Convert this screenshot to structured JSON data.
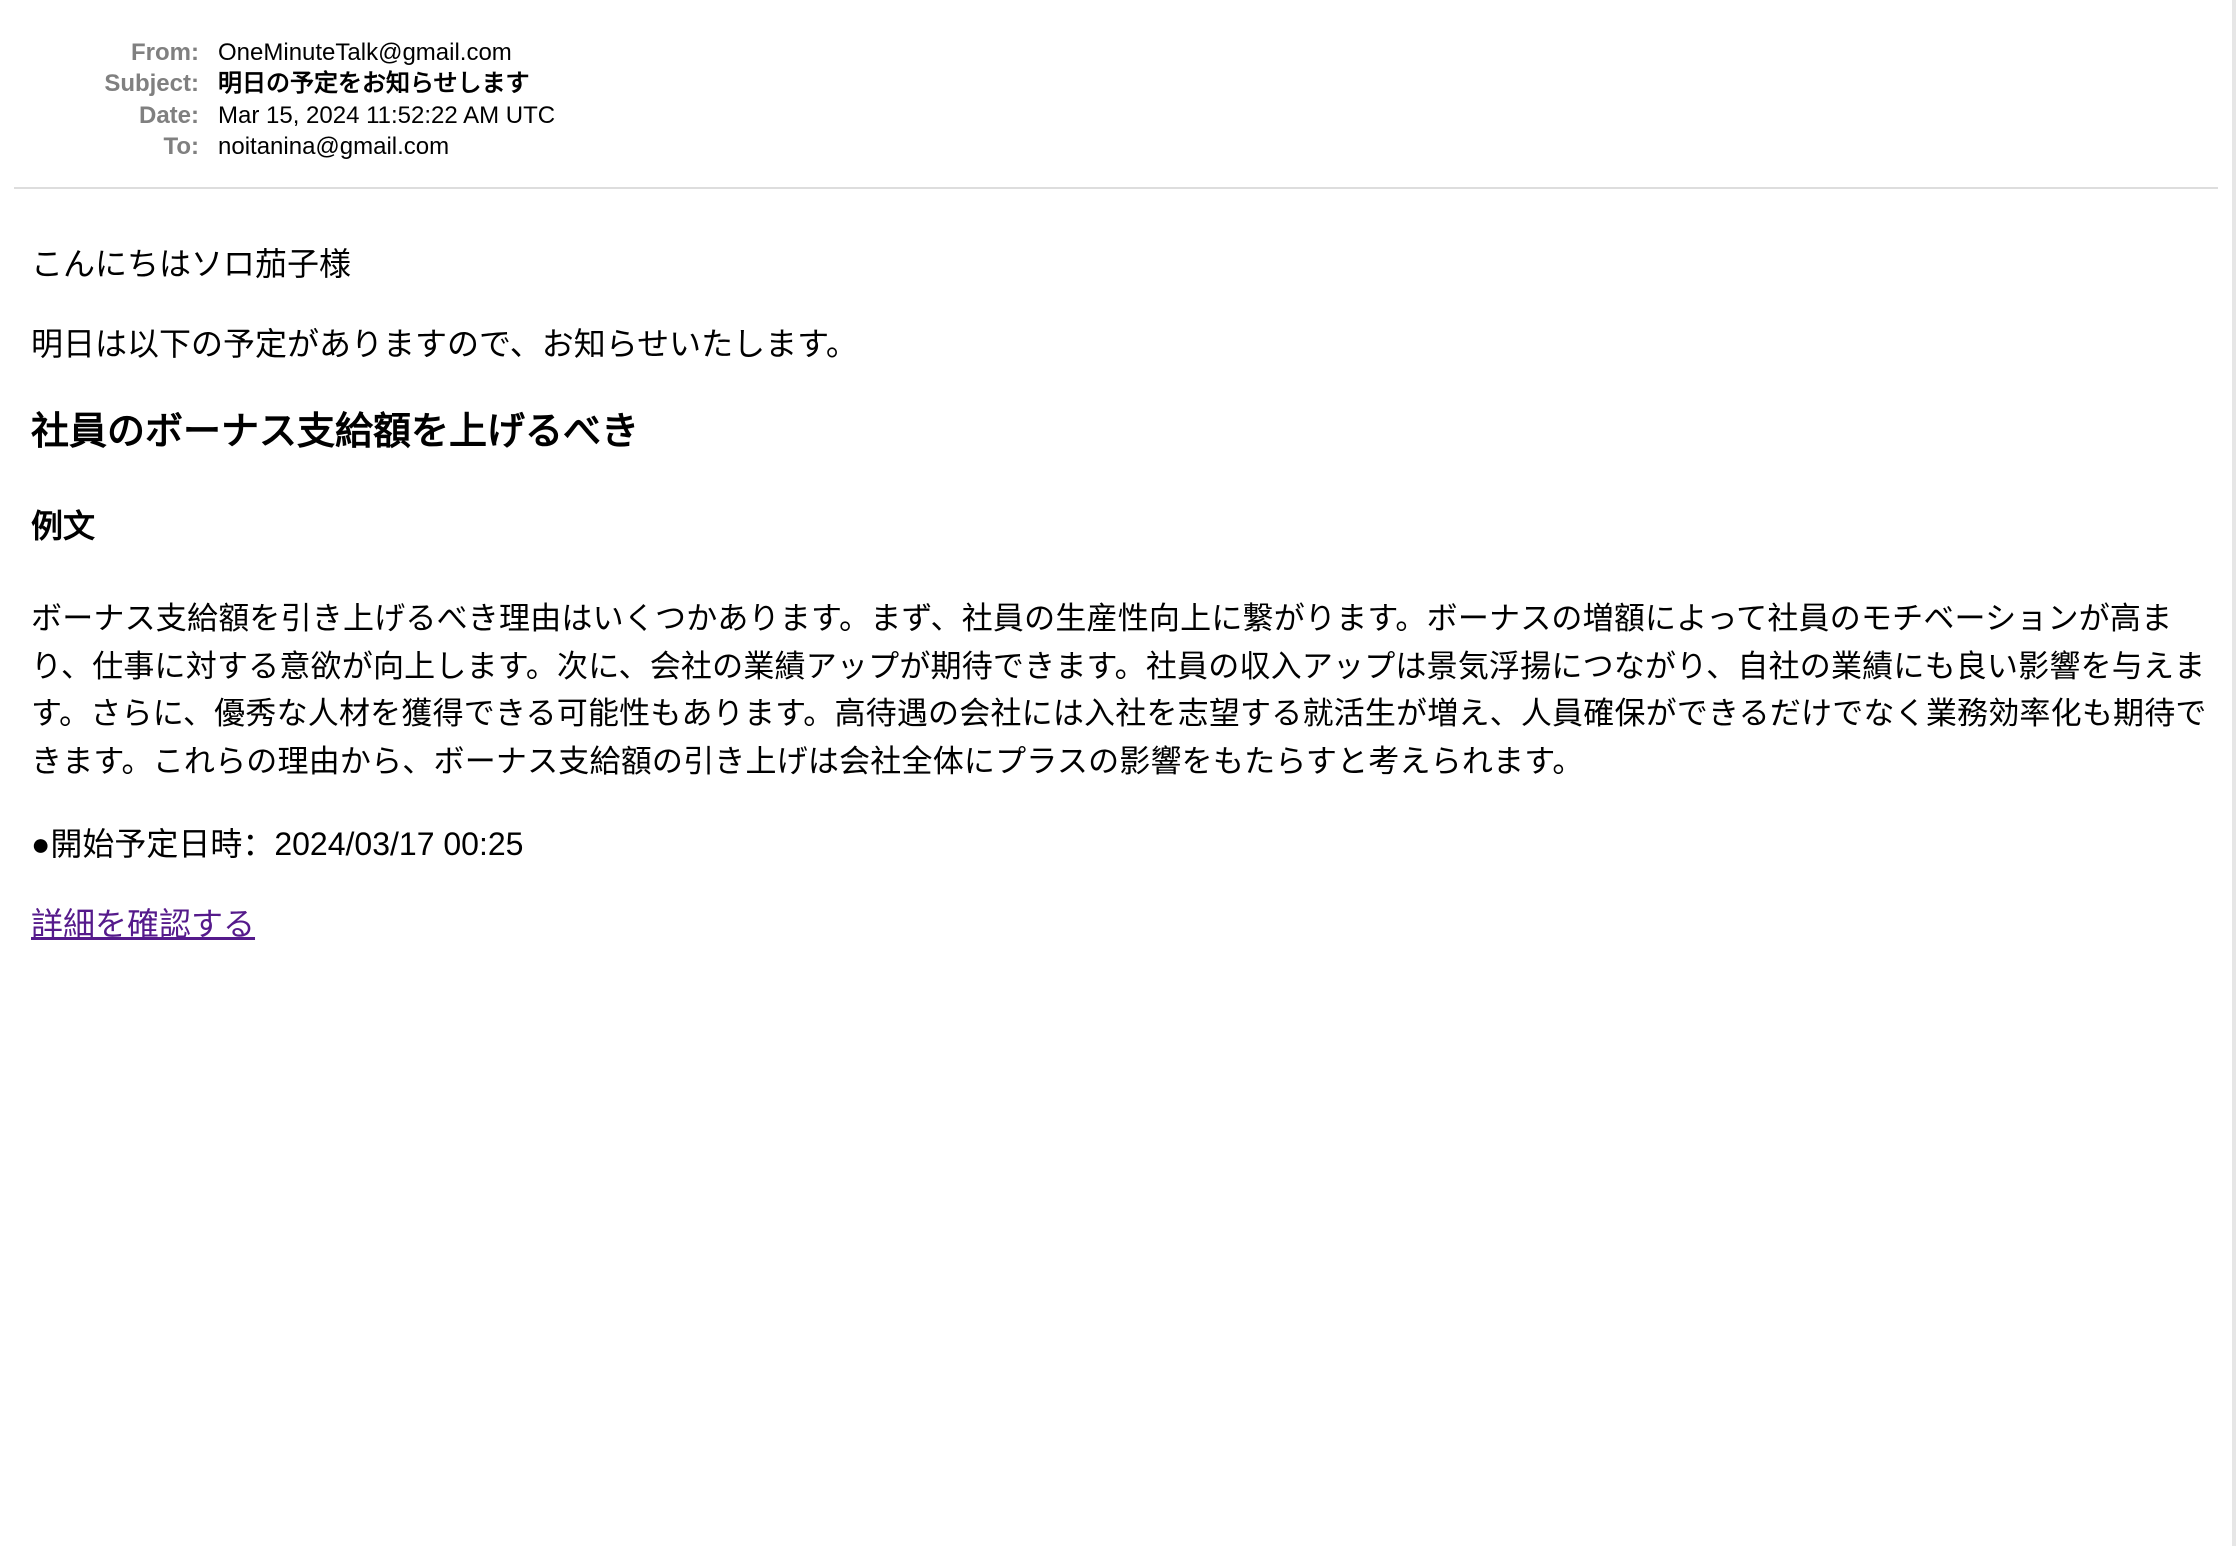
{
  "email": {
    "headers": {
      "from_label": "From:",
      "from_value": "OneMinuteTalk@gmail.com",
      "subject_label": "Subject:",
      "subject_value": "明日の予定をお知らせします",
      "date_label": "Date:",
      "date_value": "Mar 15, 2024 11:52:22 AM UTC",
      "to_label": "To:",
      "to_value": "noitanina@gmail.com"
    },
    "body": {
      "greeting": "こんにちはソロ茄子様",
      "intro": "明日は以下の予定がありますので、お知らせいたします。",
      "topic_title": "社員のボーナス支給額を上げるべき",
      "example_heading": "例文",
      "example_text": "ボーナス支給額を引き上げるべき理由はいくつかあります。まず、社員の生産性向上に繋がります。ボーナスの増額によって社員のモチベーションが高まり、仕事に対する意欲が向上します。次に、会社の業績アップが期待できます。社員の収入アップは景気浮揚につながり、自社の業績にも良い影響を与えます。さらに、優秀な人材を獲得できる可能性もあります。高待遇の会社には入社を志望する就活生が増え、人員確保ができるだけでなく業務効率化も期待できます。これらの理由から、ボーナス支給額の引き上げは会社全体にプラスの影響をもたらすと考えられます。",
      "start_time": "●開始予定日時：2024/03/17 00:25",
      "detail_link": "詳細を確認する"
    },
    "colors": {
      "label_gray": "#808080",
      "link_visited": "#551a8b",
      "divider": "#dddddd"
    }
  }
}
